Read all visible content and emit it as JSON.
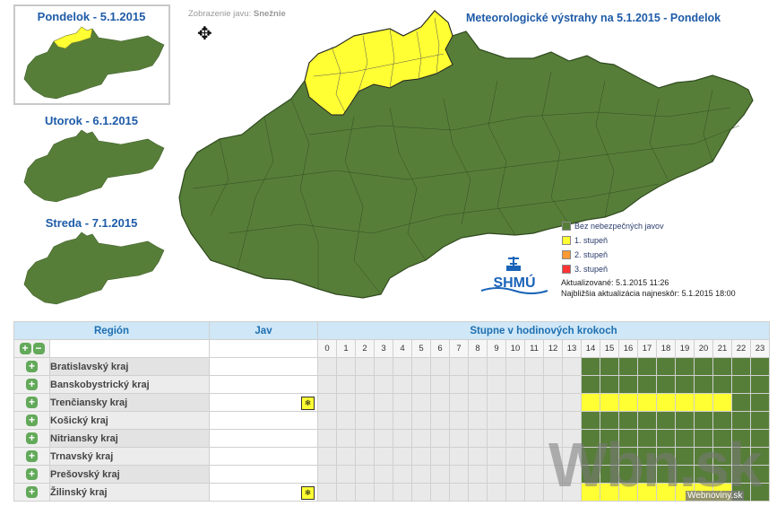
{
  "thumbs": [
    {
      "label": "Pondelok - 5.1.2015"
    },
    {
      "label": "Utorok - 6.1.2015"
    },
    {
      "label": "Streda - 7.1.2015"
    }
  ],
  "display": {
    "prefix": "Zobrazenie javu:",
    "value": "Snežnie"
  },
  "title": "Meteorologické výstrahy na 5.1.2015 - Pondelok",
  "legend": [
    {
      "label": "Bez nebezpečných javov",
      "color": "#577e39"
    },
    {
      "label": "1. stupeň",
      "color": "#ffff33"
    },
    {
      "label": "2. stupeň",
      "color": "#ff9933"
    },
    {
      "label": "3. stupeň",
      "color": "#ff3333"
    }
  ],
  "logo_text": "SHMÚ",
  "updated": "Aktualizované: 5.1.2015 11:26",
  "next_update": "Najbližšia aktualizácia najneskôr: 5.1.2015 18:00",
  "table": {
    "col_region": "Región",
    "col_jav": "Jav",
    "col_hours": "Stupne v hodinových krokoch",
    "hours": [
      "0",
      "1",
      "2",
      "3",
      "4",
      "5",
      "6",
      "7",
      "8",
      "9",
      "10",
      "11",
      "12",
      "13",
      "14",
      "15",
      "16",
      "17",
      "18",
      "19",
      "20",
      "21",
      "22",
      "23"
    ],
    "rows": [
      {
        "region": "Bratislavský kraj",
        "warn": false
      },
      {
        "region": "Banskobystrický kraj",
        "warn": false
      },
      {
        "region": "Trenčiansky kraj",
        "warn": true
      },
      {
        "region": "Košický kraj",
        "warn": false
      },
      {
        "region": "Nitriansky kraj",
        "warn": false
      },
      {
        "region": "Trnavský kraj",
        "warn": false
      },
      {
        "region": "Prešovský kraj",
        "warn": false
      },
      {
        "region": "Žilinský kraj",
        "warn": true
      }
    ]
  },
  "watermark": "Wbn.sk",
  "watermark_sub": "Webnoviny.sk"
}
